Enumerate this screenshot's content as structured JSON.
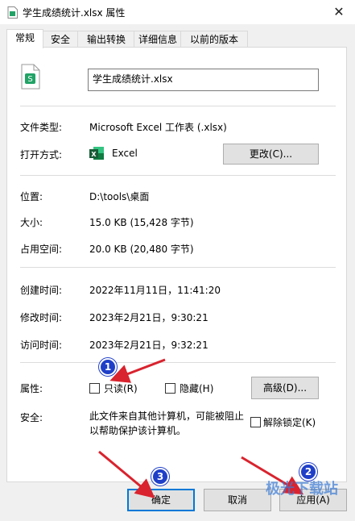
{
  "window": {
    "title": "学生成绩统计.xlsx 属性",
    "close": "✕"
  },
  "tabs": [
    "常规",
    "安全",
    "输出转换",
    "详细信息",
    "以前的版本"
  ],
  "general": {
    "filename": "学生成绩统计.xlsx",
    "file_type_label": "文件类型:",
    "file_type_value": "Microsoft Excel 工作表 (.xlsx)",
    "opens_with_label": "打开方式:",
    "opens_with_app": "Excel",
    "change_button": "更改(C)...",
    "location_label": "位置:",
    "location_value": "D:\\tools\\桌面",
    "size_label": "大小:",
    "size_value": "15.0 KB (15,428 字节)",
    "size_on_disk_label": "占用空间:",
    "size_on_disk_value": "20.0 KB (20,480 字节)",
    "created_label": "创建时间:",
    "created_value": "2022年11月11日，11:41:20",
    "modified_label": "修改时间:",
    "modified_value": "2023年2月21日，9:30:21",
    "accessed_label": "访问时间:",
    "accessed_value": "2023年2月21日，9:32:21",
    "attributes_label": "属性:",
    "readonly_label": "只读(R)",
    "hidden_label": "隐藏(H)",
    "advanced_button": "高级(D)...",
    "security_label": "安全:",
    "security_text_1": "此文件来自其他计算机，可能被阻止",
    "security_text_2": "以帮助保护该计算机。",
    "unblock_label": "解除锁定(K)"
  },
  "buttons": {
    "ok": "确定",
    "cancel": "取消",
    "apply": "应用(A)"
  },
  "annotations": {
    "badge1": "1",
    "badge2": "2",
    "badge3": "3",
    "arrow_color": "#d9232e",
    "badge_color": "#1f3fc8"
  },
  "watermark": "极光下载站"
}
